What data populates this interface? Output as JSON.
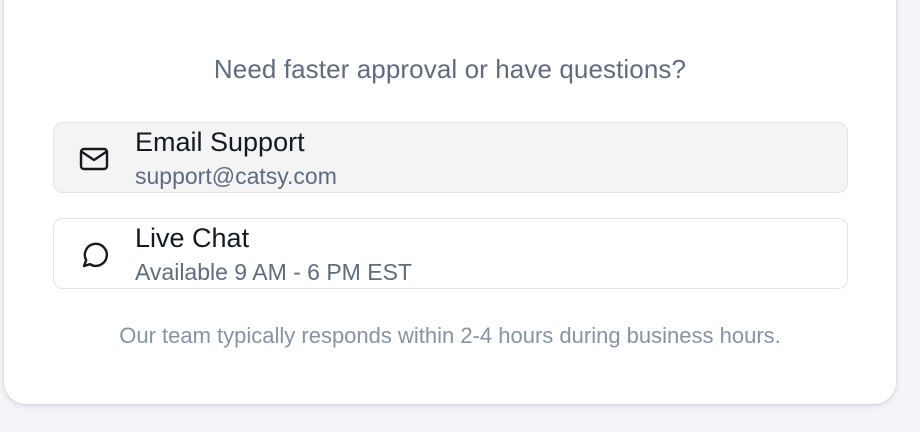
{
  "help": {
    "question": "Need faster approval or have questions?",
    "options": [
      {
        "icon": "mail-icon",
        "title": "Email Support",
        "subtitle": "support@catsy.com"
      },
      {
        "icon": "chat-bubble-icon",
        "title": "Live Chat",
        "subtitle": "Available 9 AM - 6 PM EST"
      }
    ],
    "footer": "Our team typically responds within 2-4 hours during business hours."
  },
  "colors": {
    "background": "#f3f5f9",
    "card": "#ffffff",
    "muted_text": "#5f6b80",
    "footer_text": "#8792a6",
    "title_text": "#141a24",
    "hover_fill": "#f4f4f5"
  }
}
